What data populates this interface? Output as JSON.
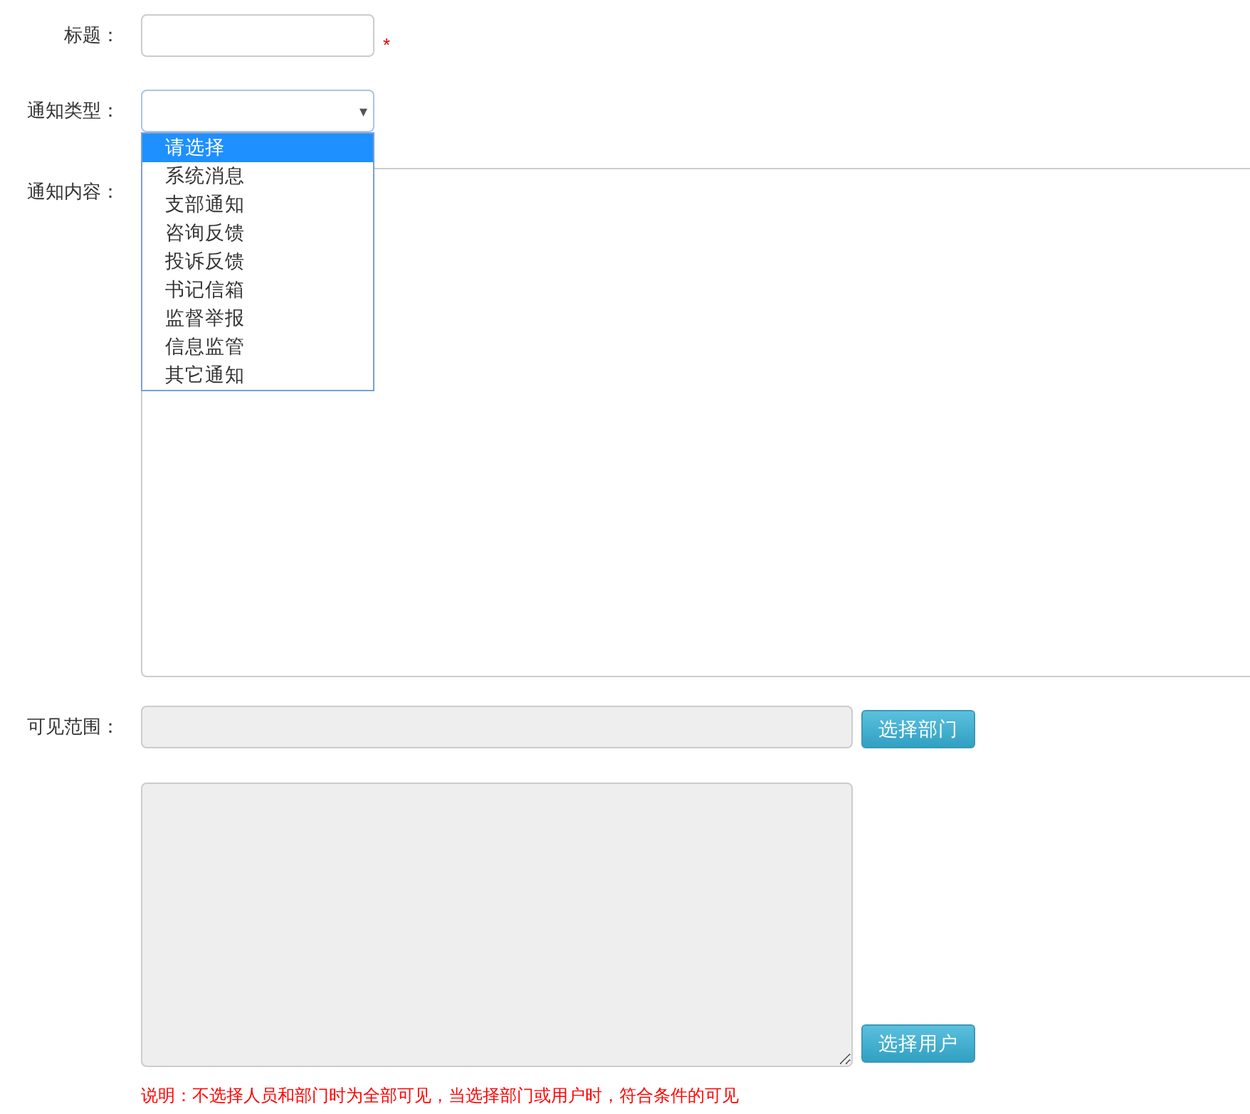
{
  "form": {
    "title_field": {
      "label": "标题：",
      "required_mark": "*"
    },
    "type_field": {
      "label": "通知类型：",
      "arrow": "▾",
      "expanded": true,
      "options": [
        {
          "label": "请选择",
          "selected": true
        },
        {
          "label": "系统消息",
          "selected": false
        },
        {
          "label": "支部通知",
          "selected": false
        },
        {
          "label": "咨询反馈",
          "selected": false
        },
        {
          "label": "投诉反馈",
          "selected": false
        },
        {
          "label": "书记信箱",
          "selected": false
        },
        {
          "label": "监督举报",
          "selected": false
        },
        {
          "label": "信息监管",
          "selected": false
        },
        {
          "label": "其它通知",
          "selected": false
        }
      ]
    },
    "content_field": {
      "label": "通知内容："
    },
    "scope_field": {
      "label": "可见范围：",
      "disabled": true,
      "button": "选择部门"
    },
    "users_field": {
      "disabled": true,
      "button": "选择用户"
    },
    "note": "说明：不选择人员和部门时为全部可见，当选择部门或用户时，符合条件的可见"
  }
}
